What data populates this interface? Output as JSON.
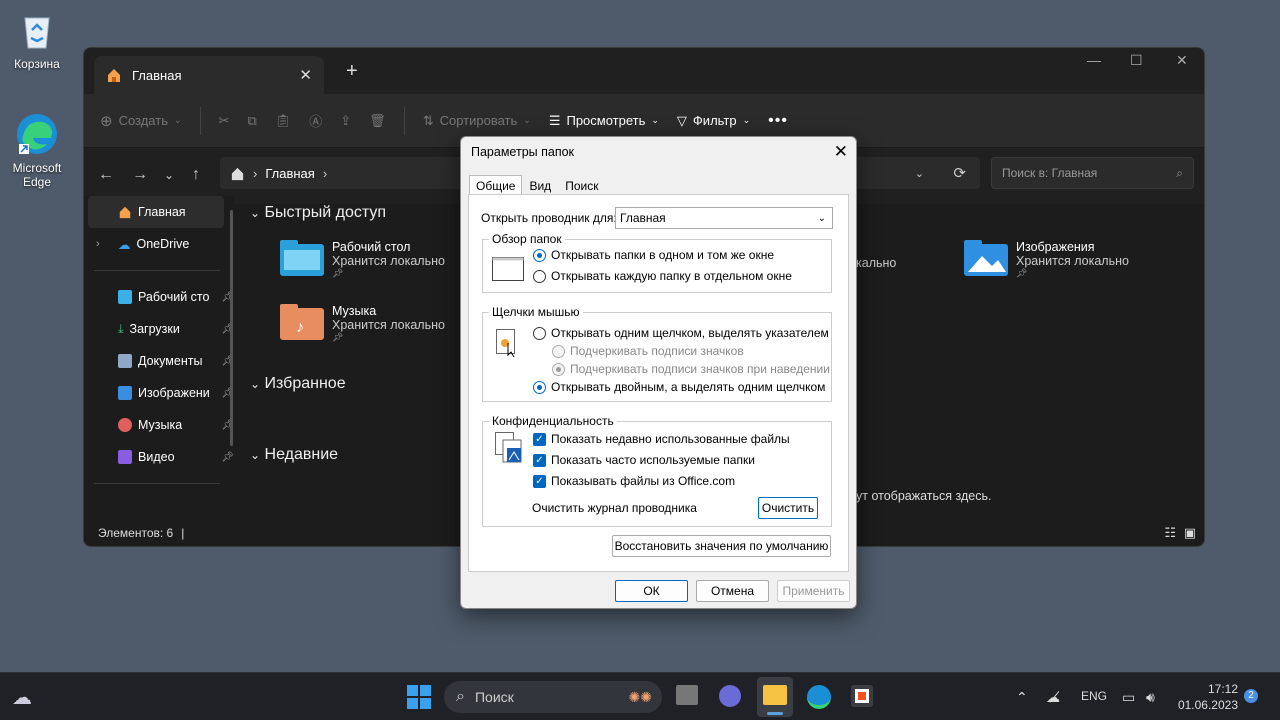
{
  "desktop": {
    "icons": [
      {
        "label": "Корзина",
        "icon": "recycle-bin-icon"
      },
      {
        "label": "Microsoft Edge",
        "icon": "edge-icon"
      }
    ]
  },
  "explorer": {
    "tab_title": "Главная",
    "toolbar": {
      "create": "Создать",
      "sort": "Сортировать",
      "view": "Просмотреть",
      "filter": "Фильтр"
    },
    "address": {
      "path": "Главная"
    },
    "search_placeholder": "Поиск в: Главная",
    "sidebar": {
      "home": "Главная",
      "onedrive": "OneDrive",
      "items": [
        {
          "label": "Рабочий сто",
          "color": "#39b0e8"
        },
        {
          "label": "Загрузки",
          "color": "#3fbf7f"
        },
        {
          "label": "Документы",
          "color": "#8fa8c8"
        },
        {
          "label": "Изображени",
          "color": "#3a8ee0"
        },
        {
          "label": "Музыка",
          "color": "#e06060"
        },
        {
          "label": "Видео",
          "color": "#8a5ce0"
        }
      ]
    },
    "groups": {
      "quick": "Быстрый доступ",
      "favorites": "Избранное",
      "recent": "Недавние"
    },
    "tiles": [
      {
        "title": "Рабочий стол",
        "sub": "Хранится локально"
      },
      {
        "title": "Музыка",
        "sub": "Хранится локально"
      },
      {
        "title": "Изображения",
        "sub": "Хранится локально"
      }
    ],
    "partial_local": "кально",
    "recent_hint": "ут отображаться здесь.",
    "status": "Элементов: 6"
  },
  "dialog": {
    "title": "Параметры папок",
    "tabs": [
      "Общие",
      "Вид",
      "Поиск"
    ],
    "open_label": "Открыть проводник для:",
    "open_value": "Главная",
    "browse": {
      "legend": "Обзор папок",
      "opt1": "Открывать папки в одном и том же окне",
      "opt2": "Открывать каждую папку в отдельном окне"
    },
    "click": {
      "legend": "Щелчки мышью",
      "single": "Открывать одним щелчком, выделять указателем",
      "underline1": "Подчеркивать подписи значков",
      "underline2": "Подчеркивать подписи значков при наведении",
      "double": "Открывать двойным, а выделять одним щелчком"
    },
    "privacy": {
      "legend": "Конфиденциальность",
      "c1": "Показать недавно использованные файлы",
      "c2": "Показать часто используемые папки",
      "c3": "Показывать файлы из Office.com",
      "clear_label": "Очистить журнал проводника",
      "clear_btn": "Очистить"
    },
    "restore": "Восстановить значения по умолчанию",
    "ok": "ОК",
    "cancel": "Отмена",
    "apply": "Применить"
  },
  "taskbar": {
    "search": "Поиск",
    "lang": "ENG",
    "time": "17:12",
    "date": "01.06.2023",
    "badge": "2"
  }
}
